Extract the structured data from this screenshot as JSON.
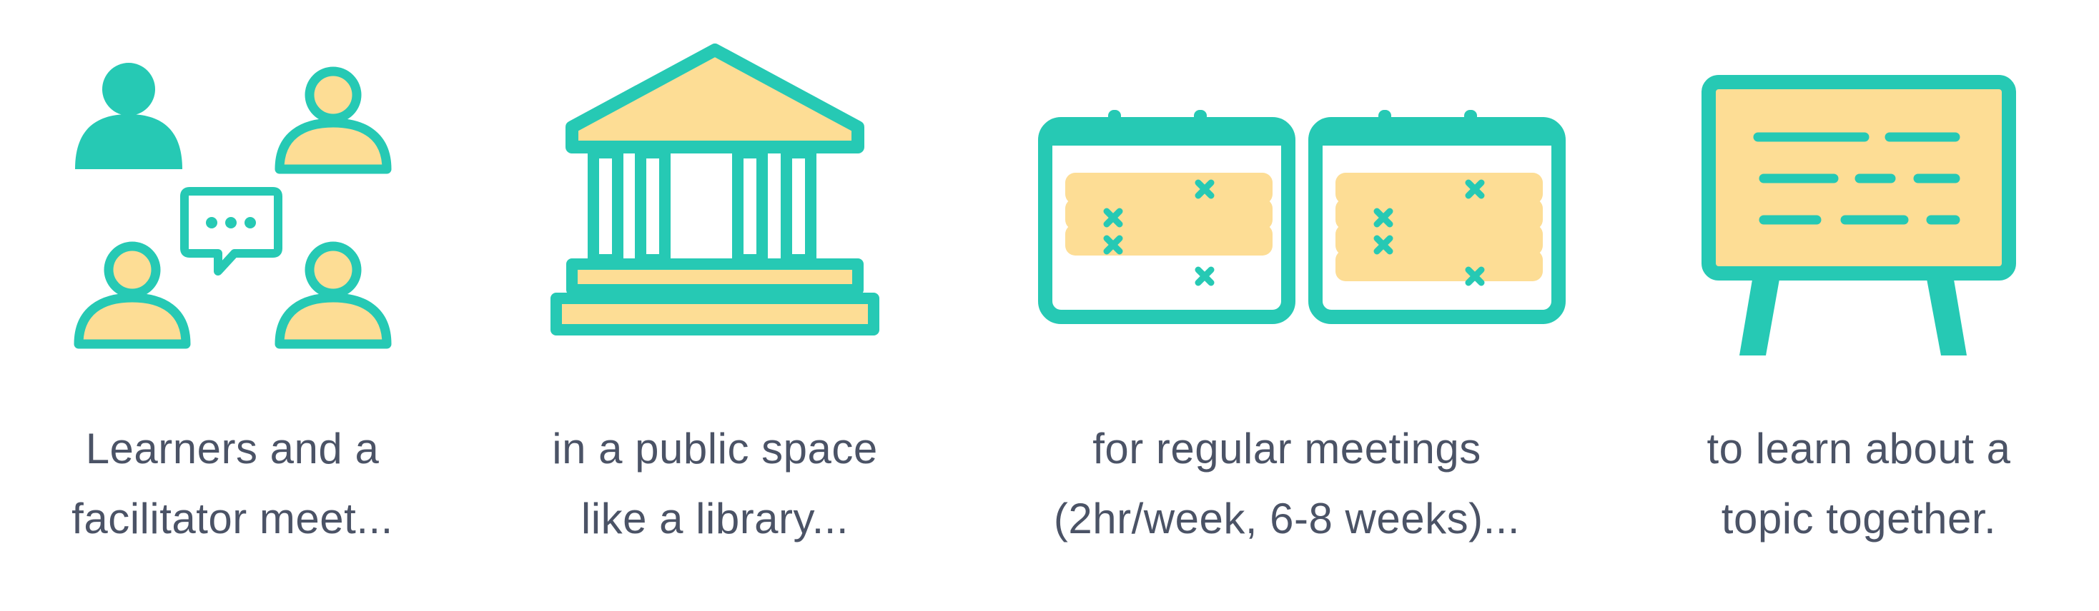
{
  "colors": {
    "teal": "#26c9b4",
    "yellow": "#fddd95",
    "text": "#4b5366"
  },
  "steps": [
    {
      "icon": "people-conversation-icon",
      "line1": "Learners and a",
      "line2": "facilitator meet..."
    },
    {
      "icon": "library-building-icon",
      "line1": "in a public space",
      "line2": "like a library..."
    },
    {
      "icon": "calendar-icon",
      "line1": "for regular meetings",
      "line2": "(2hr/week, 6-8 weeks)..."
    },
    {
      "icon": "whiteboard-easel-icon",
      "line1": "to learn about a",
      "line2": "topic together."
    }
  ]
}
